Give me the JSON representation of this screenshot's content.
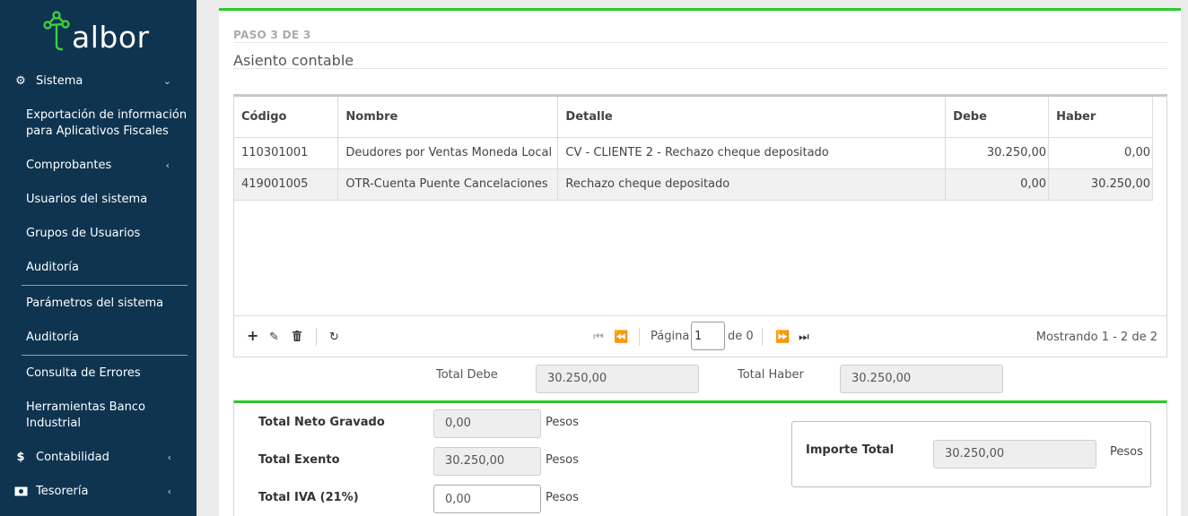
{
  "brand": {
    "name": "albor"
  },
  "sidebar": {
    "sistema": "Sistema",
    "items": [
      "Exportación de información para Aplicativos Fiscales",
      "Comprobantes",
      "Usuarios del sistema",
      "Grupos de Usuarios",
      "Auditoría",
      "Parámetros del sistema",
      "Auditoría",
      "Consulta de Errores",
      "Herramientas Banco Industrial"
    ],
    "contabilidad": "Contabilidad",
    "tesoreria": "Tesorería"
  },
  "wizard": {
    "step": "PASO 3 DE 3",
    "title": "Asiento contable"
  },
  "grid": {
    "columns": [
      "Código",
      "Nombre",
      "Detalle",
      "Debe",
      "Haber"
    ],
    "rows": [
      [
        "110301001",
        "Deudores por Ventas Moneda Local",
        "CV - CLIENTE 2 - Rechazo cheque depositado",
        "30.250,00",
        "0,00"
      ],
      [
        "419001005",
        "OTR-Cuenta Puente Cancelaciones",
        "Rechazo cheque depositado",
        "0,00",
        "30.250,00"
      ]
    ],
    "pager": {
      "page_label": "Página",
      "page_value": "1",
      "of_label": "de 0",
      "info": "Mostrando 1 - 2 de 2"
    }
  },
  "totals": {
    "debe_label": "Total Debe",
    "debe_value": "30.250,00",
    "haber_label": "Total Haber",
    "haber_value": "30.250,00"
  },
  "summary": {
    "neto_label": "Total Neto Gravado",
    "neto_value": "0,00",
    "exento_label": "Total Exento",
    "exento_value": "30.250,00",
    "iva_label": "Total IVA (21%)",
    "iva_value": "0,00",
    "unit": "Pesos",
    "importe_label": "Importe Total",
    "importe_value": "30.250,00"
  },
  "colors": {
    "sidebar": "#0e3450",
    "accent": "#2bc92b",
    "logo_icon": "#3ccf3c"
  }
}
